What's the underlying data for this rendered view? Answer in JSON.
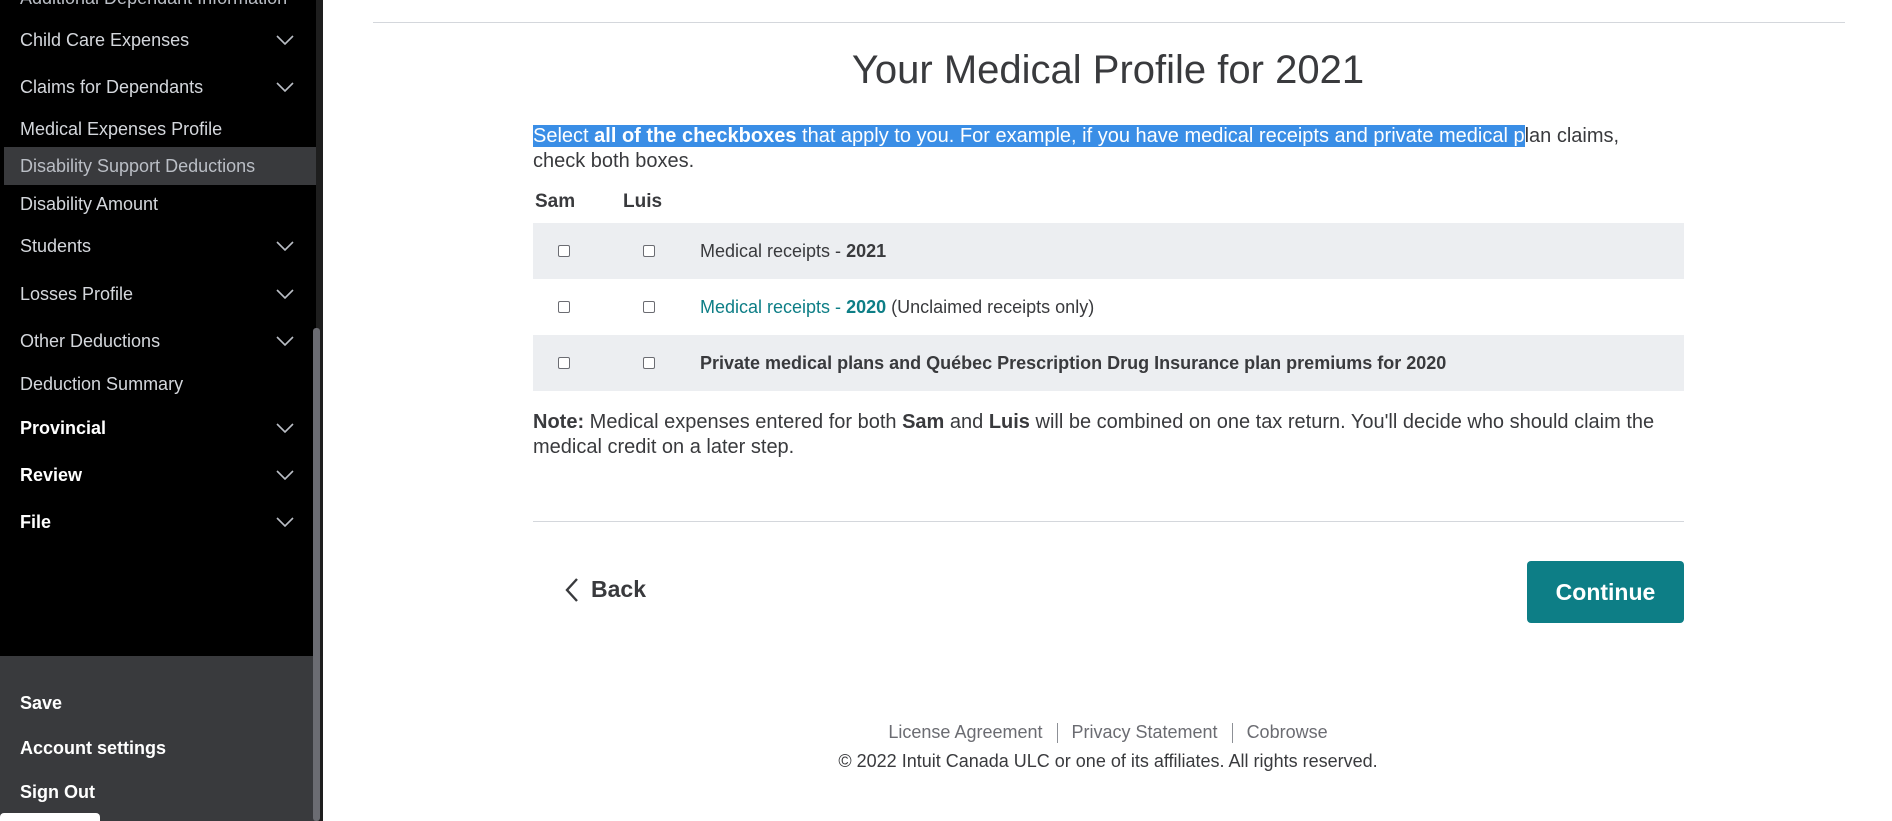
{
  "sidebar": {
    "cut_off_label": "Additional Dependant Information",
    "items": [
      {
        "label": "Child Care Expenses",
        "chevron": "chevron-down-icon"
      },
      {
        "label": "Claims for Dependants",
        "chevron": "chevron-down-icon"
      },
      {
        "label": "Medical Expenses Profile"
      },
      {
        "label": "Disability Support Deductions",
        "selected": true
      },
      {
        "label": "Disability Amount"
      },
      {
        "label": "Students",
        "chevron": "chevron-down-icon"
      },
      {
        "label": "Losses Profile",
        "chevron": "chevron-down-icon"
      },
      {
        "label": "Other Deductions",
        "chevron": "chevron-down-icon"
      },
      {
        "label": "Deduction Summary"
      },
      {
        "label": "Provincial",
        "chevron": "chevron-down-icon"
      },
      {
        "label": "Review",
        "chevron": "chevron-down-icon"
      },
      {
        "label": "File",
        "chevron": "chevron-down-icon"
      }
    ],
    "bottom": {
      "save": "Save",
      "account_settings": "Account settings",
      "sign_out": "Sign Out"
    }
  },
  "main": {
    "title": "Your Medical Profile for 2021",
    "instructions": {
      "part1": "Select ",
      "bold": "all of the checkboxes",
      "part2": " that apply to you. For example, if you have medical receipts and private medical p",
      "part3": "lan claims, check both boxes."
    },
    "columns": [
      "Sam",
      "Luis"
    ],
    "rows": [
      {
        "prefix": "Medical receipts - ",
        "year": "2021",
        "suffix": ""
      },
      {
        "prefix": "Medical receipts - ",
        "year": "2020",
        "suffix": " (Unclaimed receipts only)"
      },
      {
        "label": "Private medical plans and Québec Prescription Drug Insurance plan premiums for 2020"
      }
    ],
    "note": {
      "label": "Note:",
      "text1": " Medical expenses entered for both ",
      "name1": "Sam",
      "text2": " and ",
      "name2": "Luis",
      "text3": " will be combined on one tax return. You'll decide who should claim the medical credit on a later step."
    },
    "back_label": "Back",
    "continue_label": "Continue"
  },
  "footer": {
    "links": [
      "License Agreement",
      "Privacy Statement",
      "Cobrowse"
    ],
    "copyright": "© 2022 Intuit Canada ULC or one of its affiliates. All rights reserved."
  },
  "colors": {
    "sidebar_bg": "#000000",
    "sidebar_bottom_bg": "#393a3d",
    "accent": "#0d7e86",
    "highlight": "#3a8ee6",
    "row_shade": "#eceef1"
  }
}
